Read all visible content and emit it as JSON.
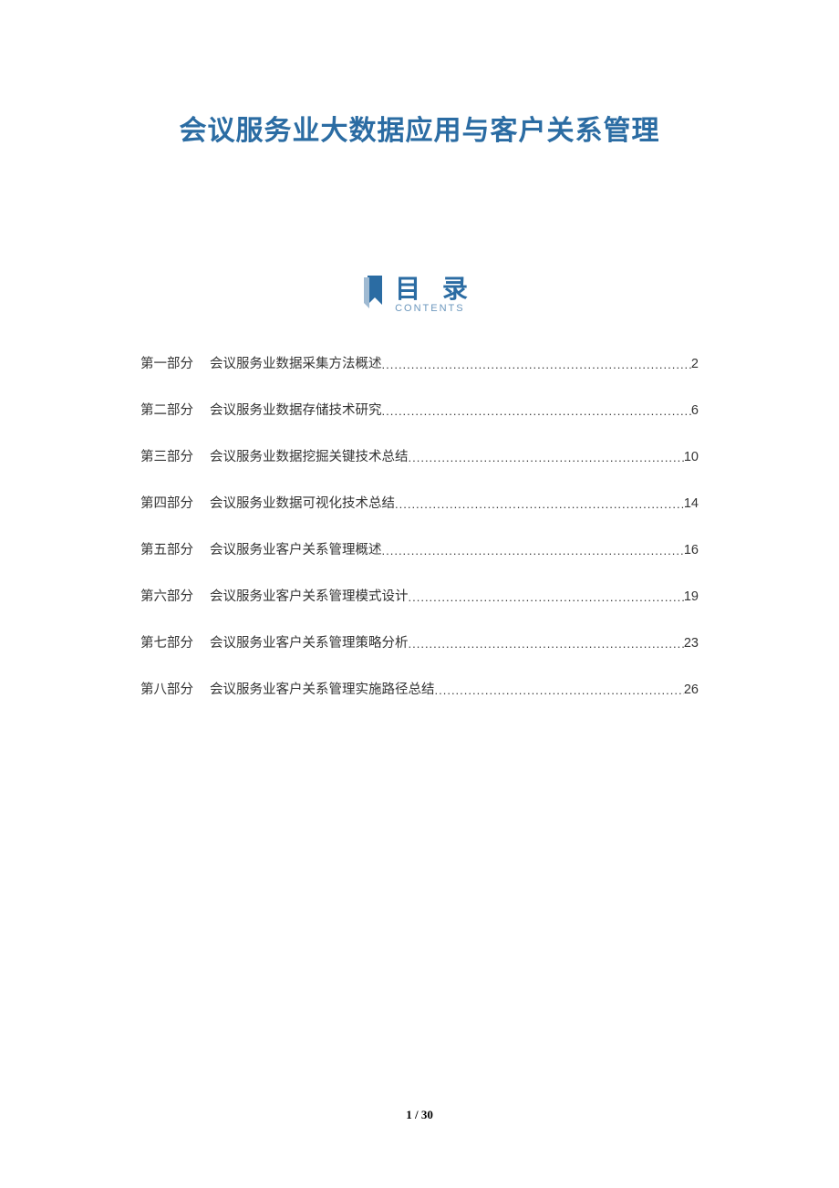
{
  "title": "会议服务业大数据应用与客户关系管理",
  "toc": {
    "label": "目 录",
    "sublabel": "CONTENTS",
    "items": [
      {
        "part": "第一部分",
        "topic": "会议服务业数据采集方法概述",
        "page": "2"
      },
      {
        "part": "第二部分",
        "topic": "会议服务业数据存储技术研究",
        "page": "6"
      },
      {
        "part": "第三部分",
        "topic": "会议服务业数据挖掘关键技术总结",
        "page": "10"
      },
      {
        "part": "第四部分",
        "topic": "会议服务业数据可视化技术总结",
        "page": "14"
      },
      {
        "part": "第五部分",
        "topic": "会议服务业客户关系管理概述",
        "page": "16"
      },
      {
        "part": "第六部分",
        "topic": "会议服务业客户关系管理模式设计",
        "page": "19"
      },
      {
        "part": "第七部分",
        "topic": "会议服务业客户关系管理策略分析",
        "page": "23"
      },
      {
        "part": "第八部分",
        "topic": "会议服务业客户关系管理实施路径总结",
        "page": "26"
      }
    ]
  },
  "footer": {
    "current": "1",
    "sep": " / ",
    "total": "30"
  }
}
